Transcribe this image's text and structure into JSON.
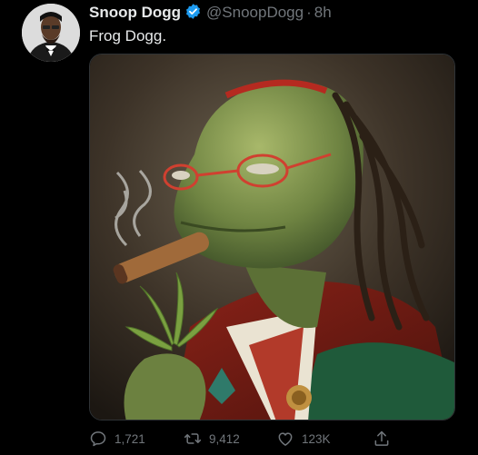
{
  "tweet": {
    "display_name": "Snoop Dogg",
    "handle": "@SnoopDogg",
    "separator": "·",
    "time": "8h",
    "text": "Frog Dogg."
  },
  "icons": {
    "verified": "verified-badge-icon",
    "reply": "reply-icon",
    "retweet": "retweet-icon",
    "like": "like-icon",
    "share": "share-icon"
  },
  "stats": {
    "replies": "1,721",
    "retweets": "9,412",
    "likes": "123K"
  },
  "colors": {
    "background": "#000000",
    "text": "#e7e9ea",
    "muted": "#71767b",
    "verified": "#1d9bf0"
  }
}
